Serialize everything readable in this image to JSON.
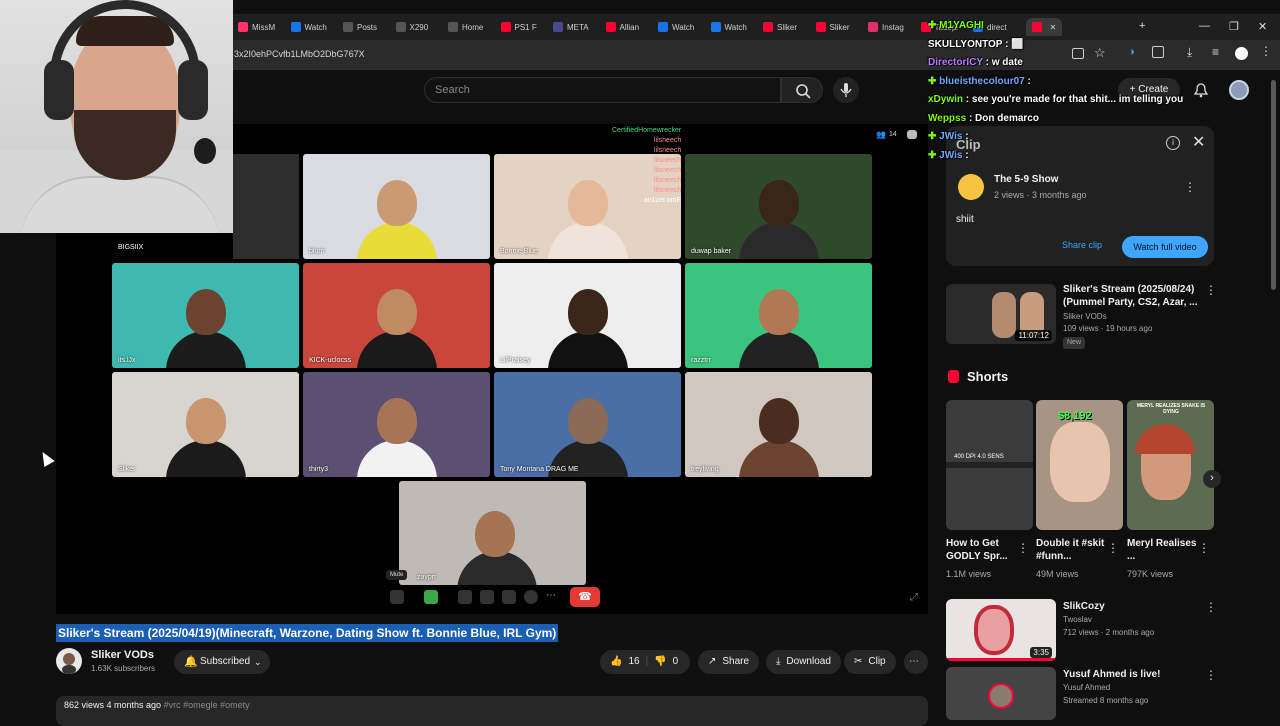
{
  "browser": {
    "tabs": [
      {
        "label": "MissM",
        "color": "#ff3366"
      },
      {
        "label": "Watch",
        "color": "#1a73e8"
      },
      {
        "label": "Posts",
        "color": "#555555"
      },
      {
        "label": "X290",
        "color": "#555555"
      },
      {
        "label": "Home",
        "color": "#555555"
      },
      {
        "label": "PS1 F",
        "color": "#ff0033"
      },
      {
        "label": "META",
        "color": "#4a4a8a"
      },
      {
        "label": "Allian",
        "color": "#ff0033"
      },
      {
        "label": "Watch",
        "color": "#1a73e8"
      },
      {
        "label": "Watch",
        "color": "#1a73e8"
      },
      {
        "label": "Sliker",
        "color": "#ff0033"
      },
      {
        "label": "Sliker",
        "color": "#ff0033"
      },
      {
        "label": "Instag",
        "color": "#e1306c"
      },
      {
        "label": "Tadepl",
        "color": "#ff0033"
      },
      {
        "label": "direct",
        "color": "#1a73e8"
      },
      {
        "label": "",
        "color": "#ff0033"
      }
    ],
    "url": "3x2I0ehPCvfb1LMbO2DbG767X",
    "new_tab": "+",
    "min": "—",
    "max": "❐",
    "close": "✕"
  },
  "youtube": {
    "search_placeholder": "Search",
    "create_label": "Create"
  },
  "player": {
    "participants": [
      "BIGSIIX",
      "blurri",
      "Bonnie Blue",
      "duwap baker",
      "its.lJx",
      "KICK-uclocss",
      "LilPraisey",
      "razztrr",
      "Sliker",
      "thirty3",
      "Tony Montana DRAG ME",
      "treyliving",
      "zayprr"
    ],
    "chat_names": [
      "CertifiedHomewrecker",
      "lilsneech",
      "lilsneech",
      "lilsneech",
      "lilsneech",
      "lilsneech",
      "lilsneech"
    ],
    "chat_last": "an1zet  omE",
    "viewer_count": "14",
    "mute_tooltip": "Mute"
  },
  "video": {
    "title": "Sliker's Stream (2025/04/19)(Minecraft, Warzone, Dating Show ft. Bonnie Blue, IRL Gym)",
    "channel": "Sliker VODs",
    "subscribers": "1.63K subscribers",
    "subscribed_label": "Subscribed",
    "likes": "16",
    "dislikes": "0",
    "share": "Share",
    "download": "Download",
    "clip": "Clip",
    "more": "⋯",
    "desc_meta": "862 views  4 months ago",
    "desc_tags": "#vrc #omegle #omety"
  },
  "clip_panel": {
    "label": "Clip",
    "channel": "The 5-9 Show",
    "meta": "2 views · 3 months ago",
    "caption": "shiit",
    "share_clip": "Share clip",
    "watch_full": "Watch full video"
  },
  "recommended": [
    {
      "title": "Sliker's Stream (2025/08/24) (Pummel Party, CS2, Azar, ...",
      "channel": "Sliker VODs",
      "meta": "109 views · 19 hours ago",
      "badge": "New",
      "duration": "11:07:12"
    }
  ],
  "shorts": {
    "heading": "Shorts",
    "items": [
      {
        "title": "How to Get GODLY Spr...",
        "views": "1.1M views",
        "overlay": "400 DPI 4.0 SENS"
      },
      {
        "title": "Double it #skit #funn...",
        "views": "49M views",
        "overlay": "$8,192"
      },
      {
        "title": "Meryl Realises ...",
        "views": "797K views",
        "overlay": "MERYL REALIZES SNAKE IS DYING"
      }
    ]
  },
  "more_videos": [
    {
      "title": "SlikCozy",
      "channel": "Twoslav",
      "meta": "712 views · 2 months ago",
      "duration": "3:35"
    },
    {
      "title": "Yusuf Ahmed is live!",
      "channel": "Yusuf Ahmed",
      "meta": "Streamed 8 months ago",
      "duration": ""
    }
  ],
  "overlay_chat": [
    {
      "user": "M1YAGHI",
      "msg": "",
      "color": "#7cfc00",
      "badges": true
    },
    {
      "user": "SKULLYONTOP",
      "msg": ": ⬜",
      "color": "#ffffff",
      "badges": false
    },
    {
      "user": "DirectorICY",
      "msg": ": w date",
      "color": "#b57bff",
      "badges": false
    },
    {
      "user": "blueisthecolour07",
      "msg": ":",
      "color": "#6fa8ff",
      "badges": true
    },
    {
      "user": "xDywin",
      "msg": ": see you're made for that shit... im telling you",
      "color": "#7cfc00",
      "badges": false
    },
    {
      "user": "Weppss",
      "msg": ": Don demarco",
      "color": "#7cfc00",
      "badges": false
    },
    {
      "user": "JWis",
      "msg": ":",
      "color": "#6fa8ff",
      "badges": true
    },
    {
      "user": "JWis",
      "msg": ":",
      "color": "#6fa8ff",
      "badges": true
    }
  ]
}
